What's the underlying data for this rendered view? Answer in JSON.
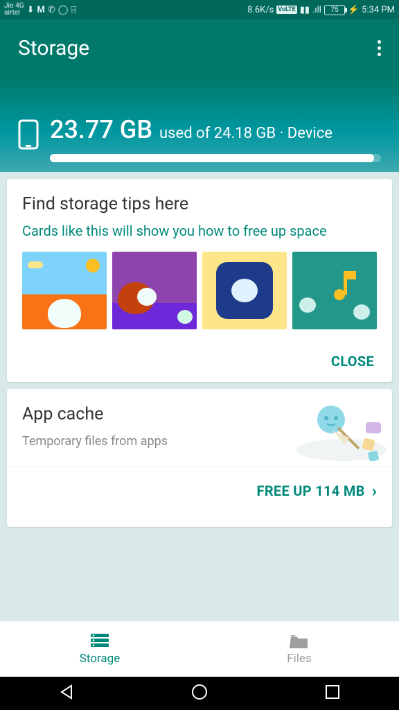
{
  "status": {
    "carrier": "Jio 4G\nairtel",
    "speed": "8.6K/s",
    "volte": "VoLTE",
    "net": "4G",
    "battery": "75",
    "time": "5:34 PM"
  },
  "header": {
    "title": "Storage"
  },
  "usage": {
    "used": "23.77 GB",
    "sub": "used of 24.18 GB · Device",
    "percent": 98
  },
  "tips": {
    "title": "Find storage tips here",
    "subtitle": "Cards like this will show you how to free up space",
    "close": "CLOSE"
  },
  "cache": {
    "title": "App cache",
    "subtitle": "Temporary files from apps",
    "action": "FREE UP 114 MB"
  },
  "nav": {
    "storage": "Storage",
    "files": "Files"
  }
}
